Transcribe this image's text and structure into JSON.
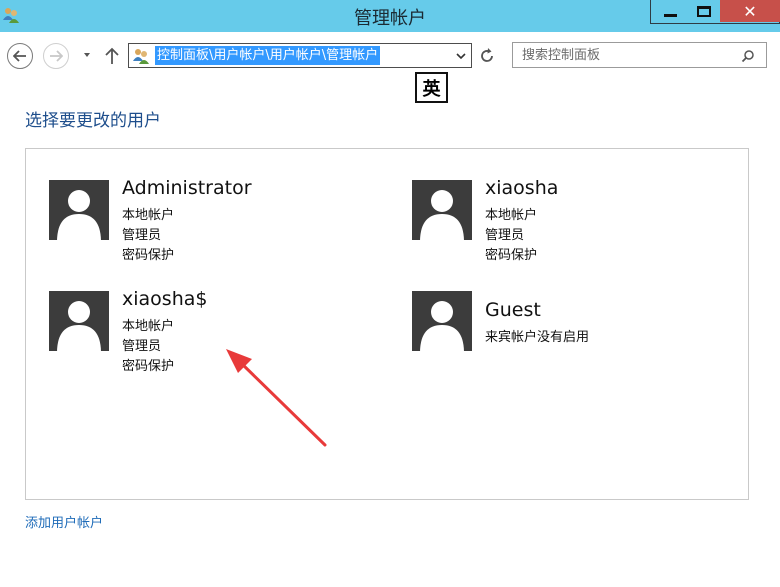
{
  "window": {
    "title": "管理帐户"
  },
  "nav": {
    "address_path": "控制面板\\用户帐户\\用户帐户\\管理帐户",
    "search_placeholder": "搜索控制面板",
    "ime_indicator": "英"
  },
  "main": {
    "heading": "选择要更改的用户",
    "users": [
      {
        "name": "Administrator",
        "lines": [
          "本地帐户",
          "管理员",
          "密码保护"
        ]
      },
      {
        "name": "xiaosha",
        "lines": [
          "本地帐户",
          "管理员",
          "密码保护"
        ]
      },
      {
        "name": "xiaosha$",
        "lines": [
          "本地帐户",
          "管理员",
          "密码保护"
        ]
      },
      {
        "name": "Guest",
        "lines": [
          "来宾帐户没有启用"
        ]
      }
    ],
    "add_user_link": "添加用户帐户"
  },
  "colors": {
    "titlebar": "#66cbea",
    "close_button": "#c7504a",
    "heading": "#1e4e8c",
    "link": "#1e6bb8",
    "selection": "#3399ff",
    "avatar": "#3c3c3c",
    "annotation": "#e83a3a"
  },
  "icons": {
    "app": "users-icon",
    "back": "back-arrow-icon",
    "forward": "forward-arrow-icon",
    "up": "up-arrow-icon",
    "refresh": "refresh-icon",
    "search": "search-icon"
  }
}
